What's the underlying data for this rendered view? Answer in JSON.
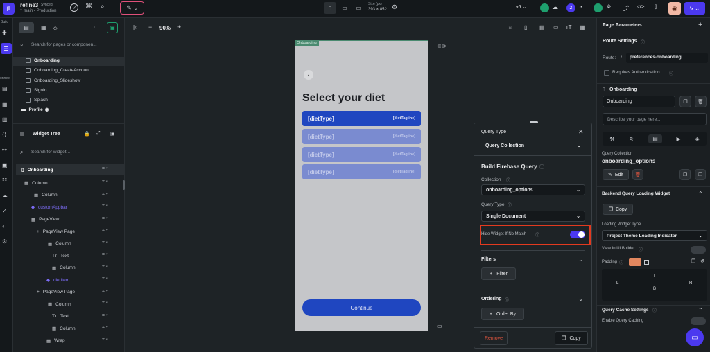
{
  "topbar": {
    "project_name": "refine3",
    "sync_status": "Synced",
    "branch": "main",
    "production": "Production",
    "size_label": "Size (px)",
    "size_value": "393 × 852",
    "version": "v6",
    "notification_count": "2"
  },
  "leftrail": {
    "build_label": "Build",
    "connect_label": "onnect"
  },
  "pages": {
    "search_placeholder": "Search for pages or componen...",
    "items": [
      "Onboarding",
      "Onboarding_CreateAccount",
      "Onboarding_Slideshow",
      "SignIn",
      "Splash"
    ],
    "folder": "Profile"
  },
  "widget_tree": {
    "title": "Widget Tree",
    "search_placeholder": "Search for widget...",
    "nodes": [
      "Onboarding",
      "Column",
      "Column",
      "customAppbar",
      "PageView",
      "PageView Page",
      "Column",
      "Text",
      "Column",
      "dietItem",
      "PageView Page",
      "Column",
      "Text",
      "Column",
      "Wrap"
    ]
  },
  "canvas": {
    "zoom": "90%",
    "page_tag": "Onboarding",
    "back_glyph": "‹",
    "heading": "Select your diet",
    "diet_type": "[dietType]",
    "diet_tagline": "[dietTagline]",
    "continue": "Continue"
  },
  "query": {
    "query_type_label": "Query Type",
    "query_type_value": "Query Collection",
    "build_title": "Build Firebase Query",
    "collection_label": "Collection",
    "collection_value": "onboarding_options",
    "qtype_label": "Query Type",
    "qtype_value": "Single Document",
    "hide_label": "Hide Widget If No Match",
    "filters": "Filters",
    "filter_btn": "Filter",
    "ordering": "Ordering",
    "order_btn": "Order By",
    "remove": "Remove",
    "copy": "Copy"
  },
  "right": {
    "page_params": "Page Parameters",
    "route_settings": "Route Settings",
    "route_label": "Route:",
    "route_slash": "/",
    "route_value": "preferences-onboarding",
    "requires_auth": "Requires Authentication",
    "page_title": "Onboarding",
    "page_name_value": "Onboarding",
    "describe_placeholder": "Describe your page here...",
    "query_collection_label": "Query Collection",
    "query_collection_value": "onboarding_options",
    "edit": "Edit",
    "backend_loading": "Backend Query Loading Widget",
    "copy": "Copy",
    "loading_widget_type": "Loading Widget Type",
    "loading_widget_value": "Project Theme Loading Indicator",
    "view_in_ui": "View In UI Builder",
    "padding": "Padding",
    "pad_t": "T",
    "pad_l": "L",
    "pad_r": "R",
    "pad_b": "B",
    "cache_settings": "Query Cache Settings",
    "enable_caching": "Enable Query Caching"
  },
  "colors": {
    "accent": "#4b39ef",
    "diet_primary": "#1f46c0",
    "diet_muted": "#7a8bd0",
    "highlight": "#e23a1f",
    "toggle_on": "#4b39ef"
  }
}
